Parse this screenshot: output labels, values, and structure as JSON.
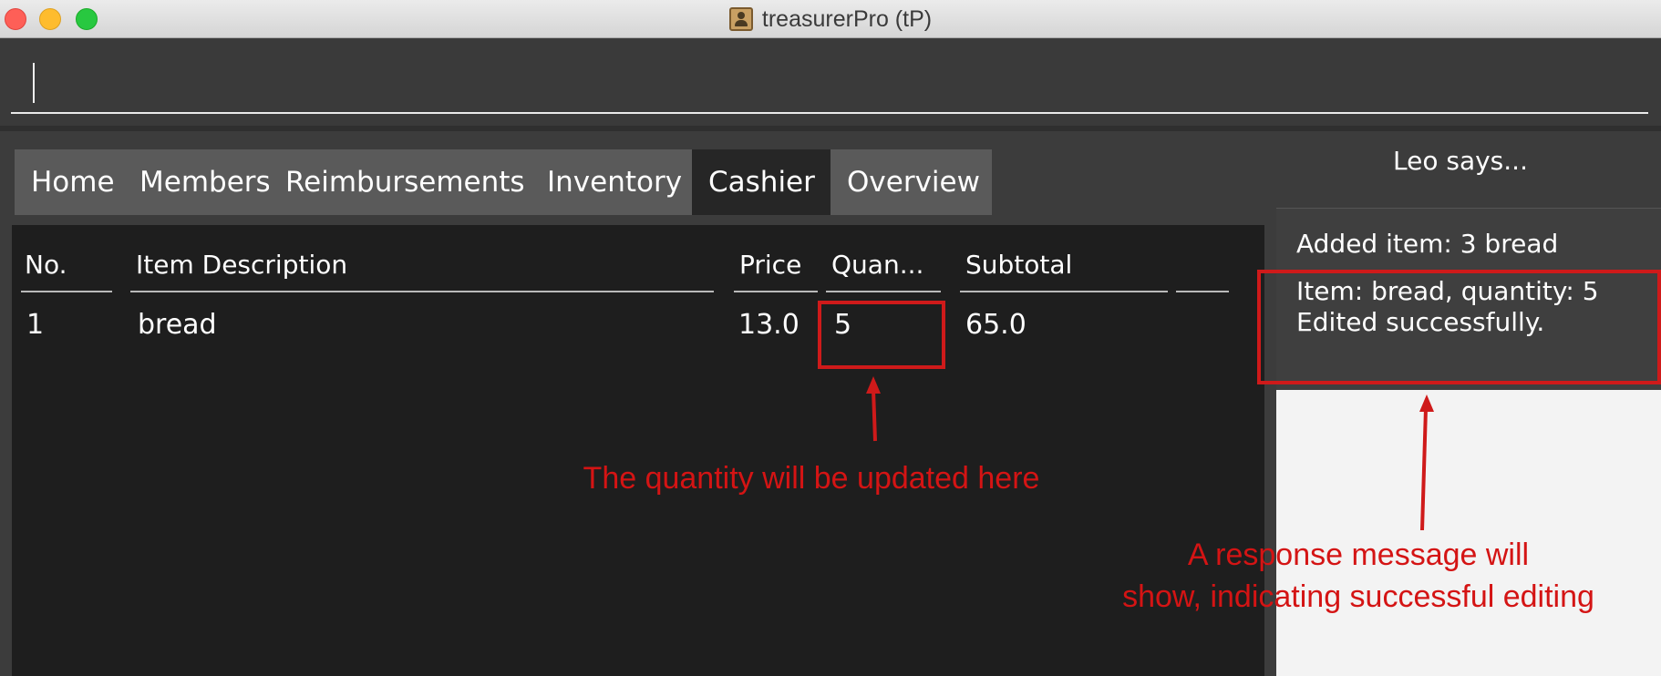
{
  "window": {
    "title": "treasurerPro (tP)"
  },
  "command_box": {
    "value": ""
  },
  "tabs": [
    {
      "label": "Home",
      "active": false
    },
    {
      "label": "Members",
      "active": false
    },
    {
      "label": "Reimbursements",
      "active": false
    },
    {
      "label": "Inventory",
      "active": false
    },
    {
      "label": "Cashier",
      "active": true
    },
    {
      "label": "Overview",
      "active": false
    }
  ],
  "table": {
    "headers": [
      "No.",
      "Item Description",
      "Price",
      "Quan...",
      "Subtotal",
      ""
    ],
    "rows": [
      {
        "no": "1",
        "description": "bread",
        "price": "13.0",
        "quantity": "5",
        "subtotal": "65.0"
      }
    ]
  },
  "assistant": {
    "title": "Leo says...",
    "messages": [
      "Added item: 3 bread",
      "Item: bread, quantity: 5",
      "Edited successfully."
    ]
  },
  "annotations": {
    "quantity_note": "The quantity will be updated here",
    "response_note_line1": "A response message will",
    "response_note_line2": "show, indicating successful editing"
  },
  "colors": {
    "annotation": "#d41414",
    "active_tab": "#262626",
    "tab": "#5a5a5a"
  },
  "icons": [
    "close-button",
    "minimize-button",
    "maximize-button",
    "app-icon"
  ]
}
